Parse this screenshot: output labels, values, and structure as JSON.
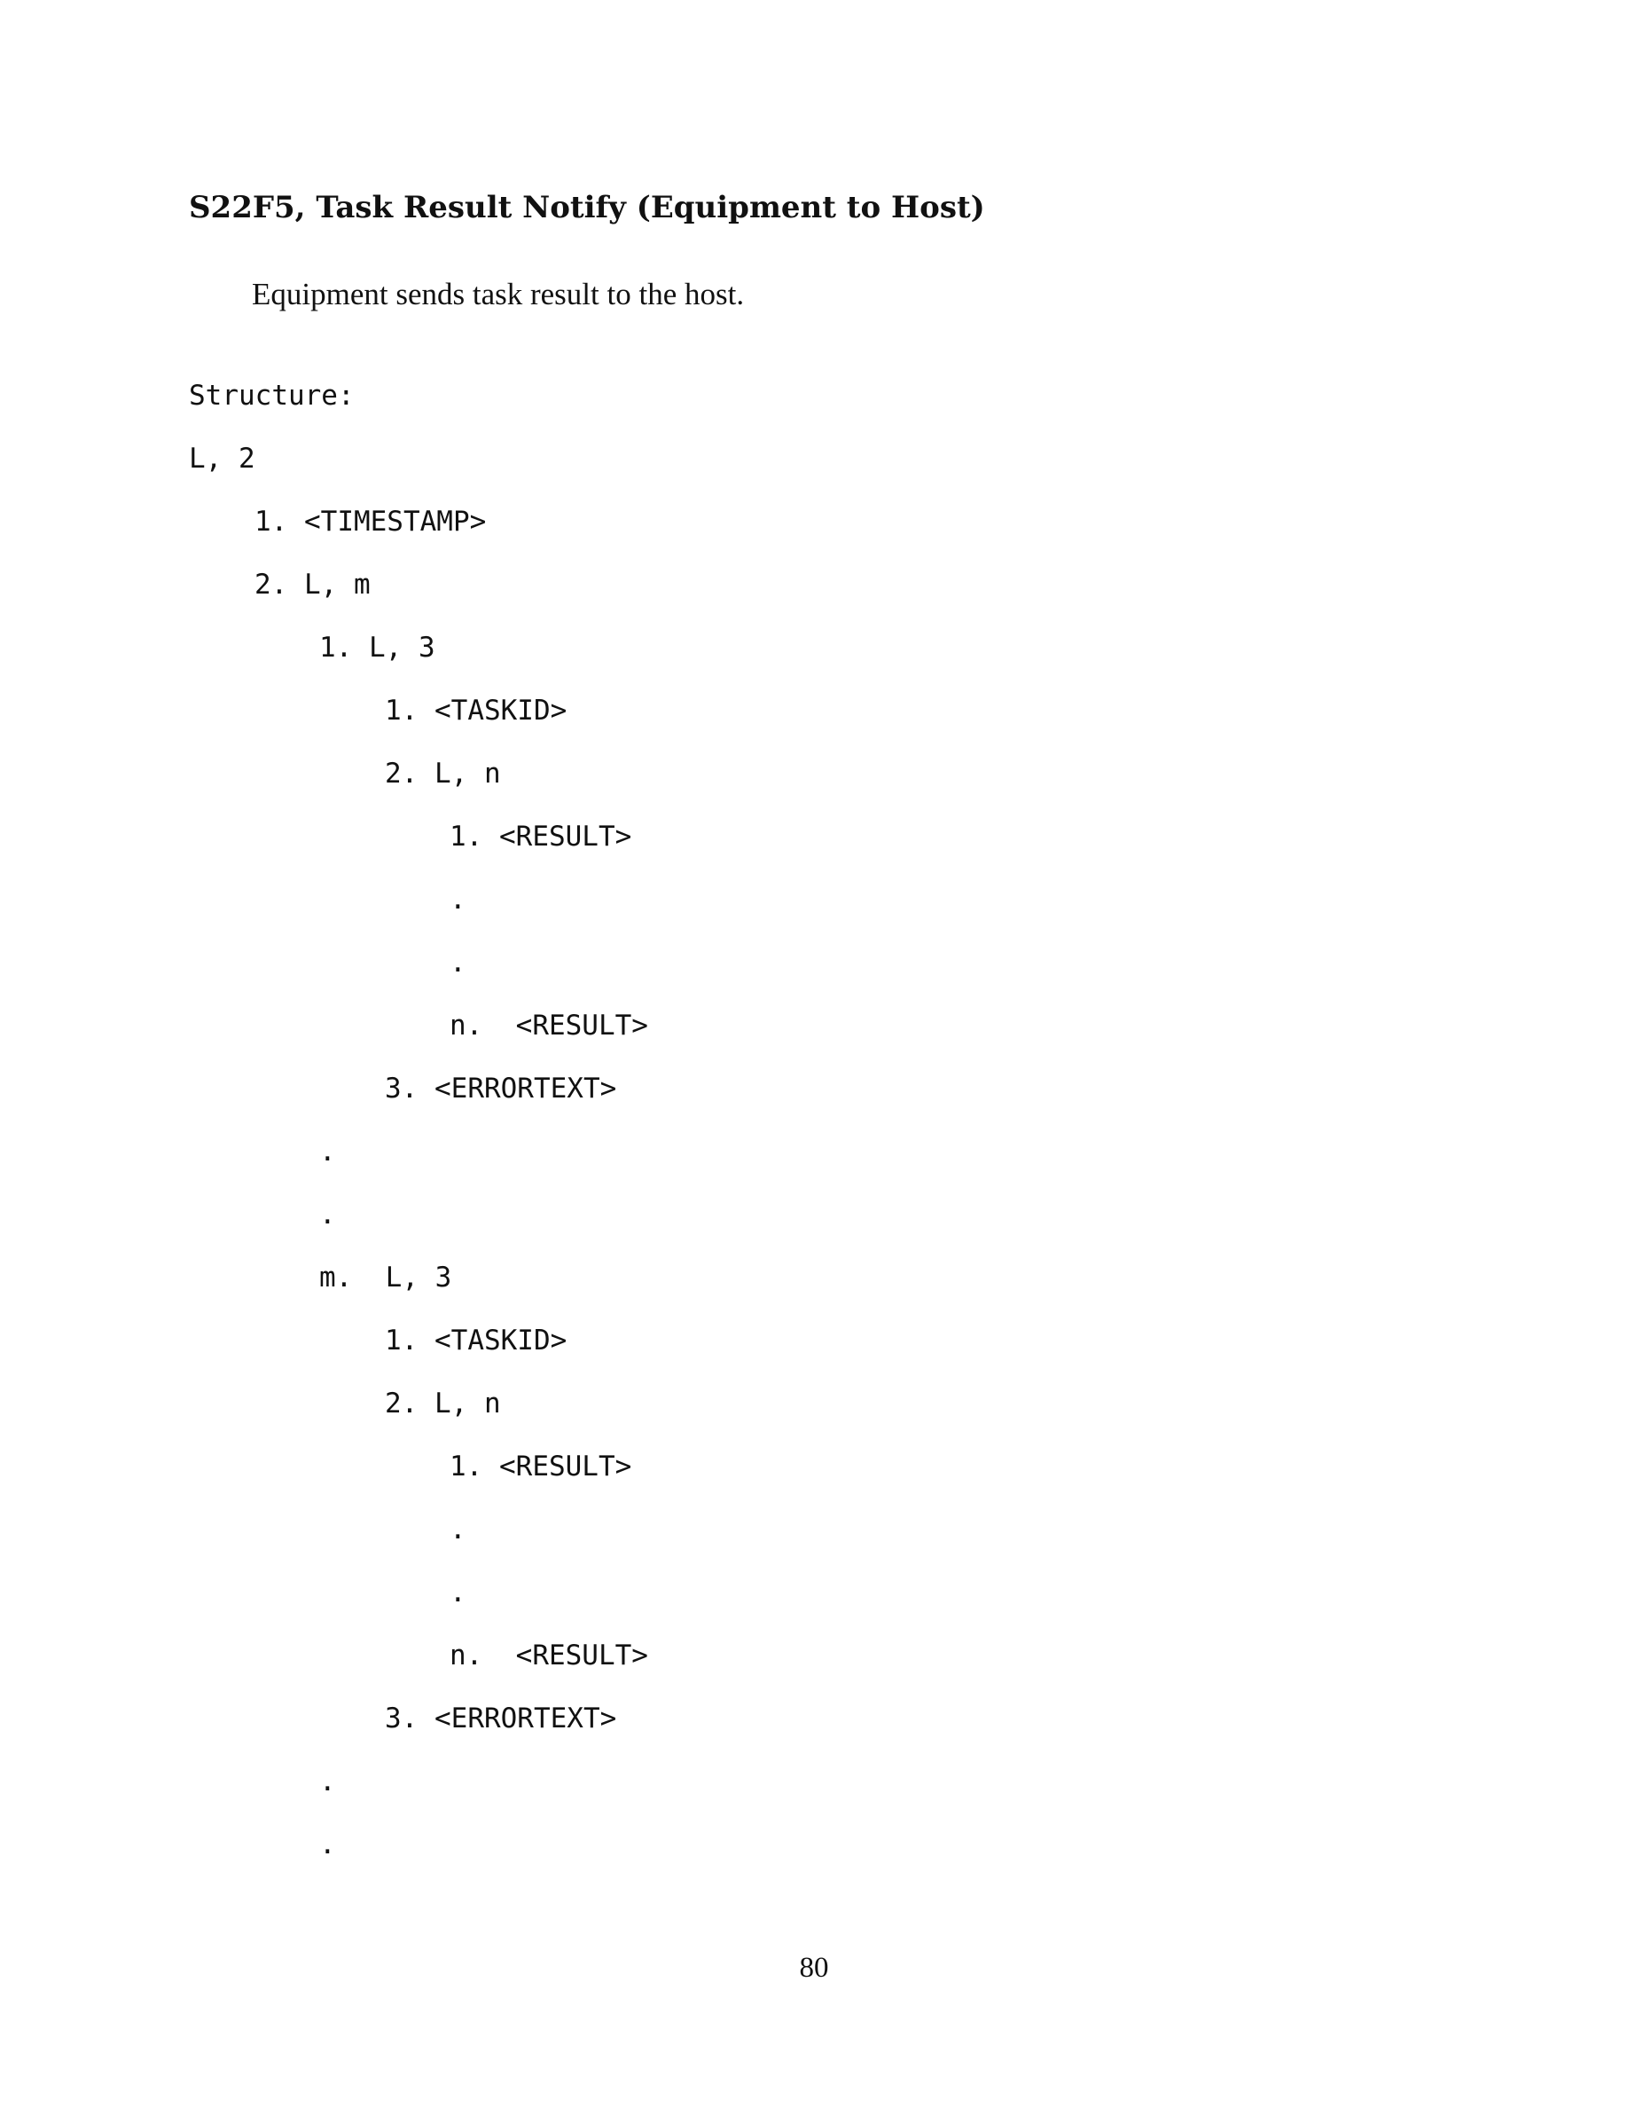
{
  "document": {
    "heading": "S22F5, Task Result Notify (Equipment to Host)",
    "intro": "Equipment sends task result to the host.",
    "structure_label": "Structure:",
    "structure_lines": [
      {
        "level": 0,
        "text": "L, 2"
      },
      {
        "level": 1,
        "text": "1. <TIMESTAMP>"
      },
      {
        "level": 1,
        "text": "2. L, m"
      },
      {
        "level": 2,
        "text": "1. L, 3"
      },
      {
        "level": 3,
        "text": "1. <TASKID>"
      },
      {
        "level": 3,
        "text": "2. L, n"
      },
      {
        "level": 4,
        "text": "1. <RESULT>"
      },
      {
        "level": 4,
        "text": "."
      },
      {
        "level": 4,
        "text": "."
      },
      {
        "level": 4,
        "text": "n.  <RESULT>"
      },
      {
        "level": 3,
        "text": "3. <ERRORTEXT>"
      },
      {
        "level": 2,
        "text": "."
      },
      {
        "level": 2,
        "text": "."
      },
      {
        "level": 2,
        "text": "m.  L, 3"
      },
      {
        "level": 3,
        "text": "1. <TASKID>"
      },
      {
        "level": 3,
        "text": "2. L, n"
      },
      {
        "level": 4,
        "text": "1. <RESULT>"
      },
      {
        "level": 4,
        "text": "."
      },
      {
        "level": 4,
        "text": "."
      },
      {
        "level": 4,
        "text": "n.  <RESULT>"
      },
      {
        "level": 3,
        "text": "3. <ERRORTEXT>"
      },
      {
        "level": 2,
        "text": "."
      },
      {
        "level": 2,
        "text": "."
      }
    ],
    "page_number": "80"
  }
}
